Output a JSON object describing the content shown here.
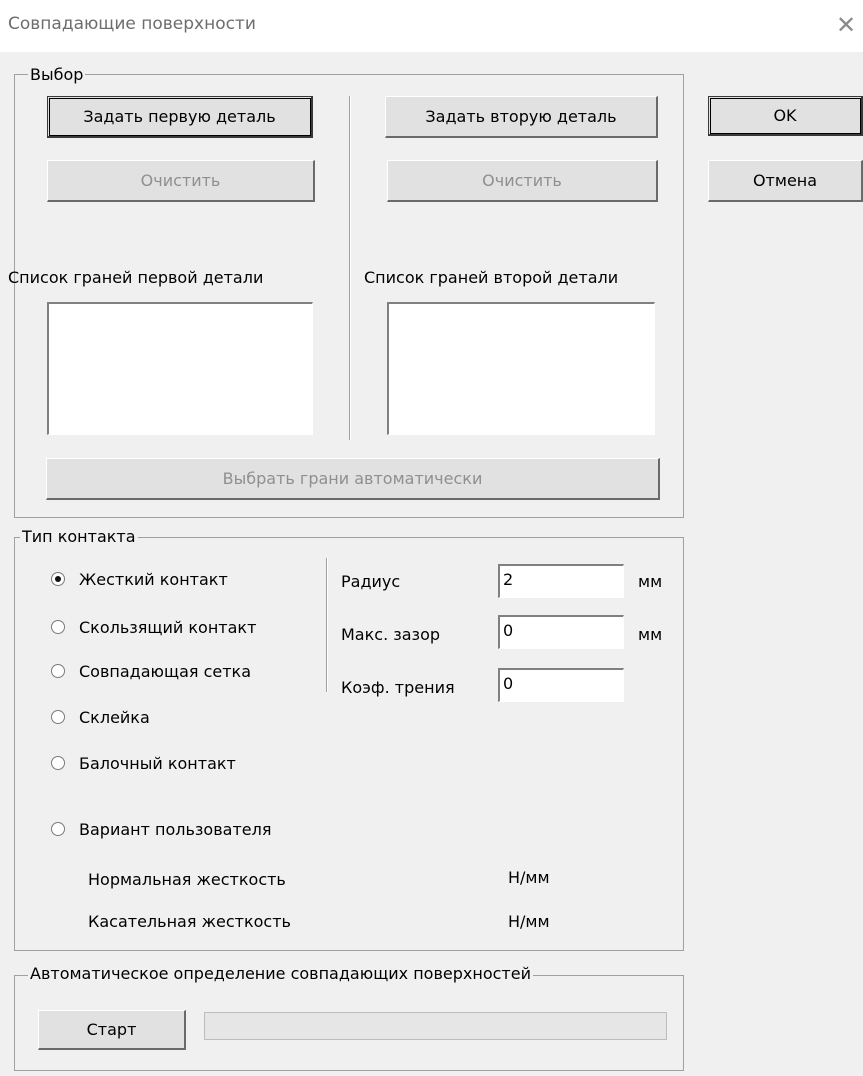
{
  "window": {
    "title": "Совпадающие поверхности"
  },
  "dialog_buttons": {
    "ok": "OK",
    "cancel": "Отмена"
  },
  "selection": {
    "legend": "Выбор",
    "first": {
      "set_button": "Задать первую деталь",
      "clear_button": "Очистить",
      "list_label": "Список граней первой детали"
    },
    "second": {
      "set_button": "Задать вторую деталь",
      "clear_button": "Очистить",
      "list_label": "Список граней второй детали"
    },
    "auto_button": "Выбрать грани автоматически"
  },
  "contact": {
    "legend": "Тип контакта",
    "options": [
      {
        "label": "Жесткий контакт",
        "checked": true
      },
      {
        "label": "Скользящий контакт",
        "checked": false
      },
      {
        "label": "Совпадающая сетка",
        "checked": false
      },
      {
        "label": "Склейка",
        "checked": false
      },
      {
        "label": "Балочный контакт",
        "checked": false
      },
      {
        "label": "Вариант пользователя",
        "checked": false
      }
    ],
    "fields": {
      "radius": {
        "label": "Радиус",
        "value": "2",
        "unit": "мм"
      },
      "max_gap": {
        "label": "Макс. зазор",
        "value": "0",
        "unit": "мм"
      },
      "friction": {
        "label": "Коэф. трения",
        "value": "0"
      }
    },
    "normal_stiffness": {
      "label": "Нормальная жесткость",
      "unit": "Н/мм"
    },
    "tangent_stiffness": {
      "label": "Касательная жесткость",
      "unit": "Н/мм"
    }
  },
  "auto_detect": {
    "legend": "Автоматическое определение совпадающих поверхностей",
    "start_button": "Старт",
    "progress": 0
  }
}
